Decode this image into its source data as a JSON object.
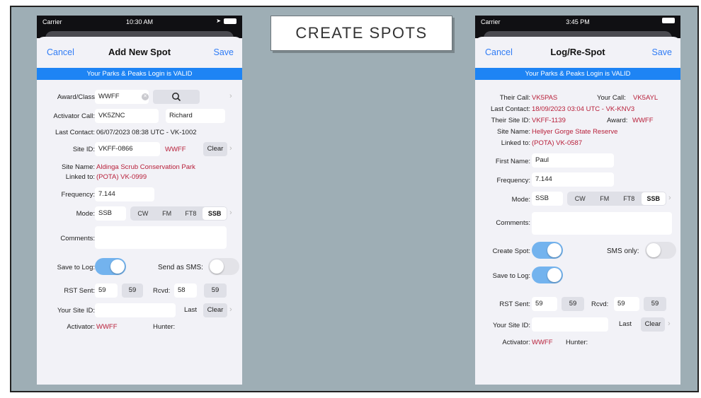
{
  "slide_title": "CREATE SPOTS",
  "colors": {
    "accent": "#2f7cf6",
    "banner": "#1e84f4",
    "red_text": "#b8203a",
    "toggle_on": "#73b3ee"
  },
  "left_phone": {
    "status": {
      "carrier": "Carrier",
      "time": "10:30 AM"
    },
    "nav": {
      "cancel": "Cancel",
      "title": "Add New Spot",
      "save": "Save"
    },
    "banner": "Your Parks & Peaks Login is VALID",
    "award_label": "Award/Class",
    "award_value": "WWFF",
    "search_icon": "search-icon",
    "activator_call_label": "Activator Call:",
    "activator_call_value": "VK5ZNC",
    "activator_name_value": "Richard",
    "last_contact_label": "Last Contact:",
    "last_contact_value": "06/07/2023 08:38 UTC - VK-1002",
    "site_id_label": "Site ID:",
    "site_id_value": "VKFF-0866",
    "site_id_program": "WWFF",
    "clear_label": "Clear",
    "site_name_label": "Site Name:",
    "site_name_value": "Aldinga Scrub Conservation Park",
    "linked_to_label": "Linked to:",
    "linked_to_value": "(POTA) VK-0999",
    "frequency_label": "Frequency:",
    "frequency_value": "7.144",
    "mode_label": "Mode:",
    "mode_value": "SSB",
    "mode_options": [
      "CW",
      "FM",
      "FT8",
      "SSB"
    ],
    "comments_label": "Comments:",
    "comments_value": "",
    "save_to_log_label": "Save to Log:",
    "save_to_log_on": true,
    "send_sms_label": "Send as SMS:",
    "send_sms_on": false,
    "rst_sent_label": "RST Sent:",
    "rst_sent_value": "59",
    "rst_sent_button": "59",
    "rcvd_label": "Rcvd:",
    "rcvd_value": "58",
    "rcvd_button": "59",
    "your_site_label": "Your Site ID:",
    "your_site_value": "",
    "last_label": "Last",
    "activator_label": "Activator:",
    "activator_value": "WWFF",
    "hunter_label": "Hunter:"
  },
  "right_phone": {
    "status": {
      "carrier": "Carrier",
      "time": "3:45 PM"
    },
    "nav": {
      "cancel": "Cancel",
      "title": "Log/Re-Spot",
      "save": "Save"
    },
    "banner": "Your Parks & Peaks Login is VALID",
    "their_call_label": "Their Call:",
    "their_call_value": "VK5PAS",
    "your_call_label": "Your Call:",
    "your_call_value": "VK5AYL",
    "last_contact_label": "Last Contact:",
    "last_contact_value": "18/09/2023 03:04 UTC - VK-KNV3",
    "their_site_label": "Their Site ID:",
    "their_site_value": "VKFF-1139",
    "award_label": "Award:",
    "award_value": "WWFF",
    "site_name_label": "Site Name:",
    "site_name_value": "Hellyer Gorge State Reserve",
    "linked_to_label": "Linked to:",
    "linked_to_value": "(POTA) VK-0587",
    "first_name_label": "First Name:",
    "first_name_value": "Paul",
    "frequency_label": "Frequency:",
    "frequency_value": "7.144",
    "mode_label": "Mode:",
    "mode_value": "SSB",
    "mode_options": [
      "CW",
      "FM",
      "FT8",
      "SSB"
    ],
    "comments_label": "Comments:",
    "comments_value": "",
    "create_spot_label": "Create Spot:",
    "create_spot_on": true,
    "sms_only_label": "SMS only:",
    "sms_only_on": false,
    "save_to_log_label": "Save to Log:",
    "save_to_log_on": true,
    "rst_sent_label": "RST Sent:",
    "rst_sent_value": "59",
    "rst_sent_button": "59",
    "rcvd_label": "Rcvd:",
    "rcvd_value": "59",
    "rcvd_button": "59",
    "your_site_label": "Your Site ID:",
    "your_site_value": "",
    "last_label": "Last",
    "clear_label": "Clear",
    "activator_label": "Activator:",
    "activator_value": "WWFF",
    "hunter_label": "Hunter:"
  }
}
